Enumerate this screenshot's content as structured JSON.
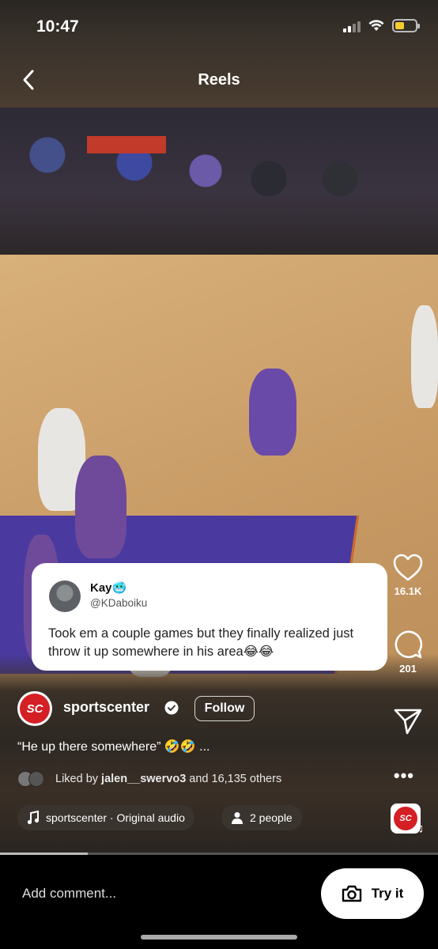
{
  "status_bar": {
    "time": "10:47",
    "battery_level": 0.45
  },
  "header": {
    "title": "Reels",
    "back_icon": "chevron-left-icon"
  },
  "tweet": {
    "name": "Kay🥶",
    "handle": "@KDaboiku",
    "text": "Took em a couple games but they finally realized just throw it up somewhere in his area😂😂"
  },
  "actions": {
    "like_count": "16.1K",
    "comment_count": "201"
  },
  "author": {
    "name": "sportscenter",
    "follow_label": "Follow",
    "caption": "“He up there somewhere” 🤣🤣 ..."
  },
  "liked_by": {
    "prefix": "Liked by",
    "user": "jalen__swervo3",
    "suffix": "and 16,135 others"
  },
  "chips": {
    "audio": "sportscenter · Original audio",
    "people": "2 people"
  },
  "bottom_bar": {
    "comment_placeholder": "Add comment...",
    "try_label": "Try it"
  },
  "progress": 0.2,
  "colors": {
    "brand_red": "#d41f25",
    "battery": "#f5cc2e"
  }
}
